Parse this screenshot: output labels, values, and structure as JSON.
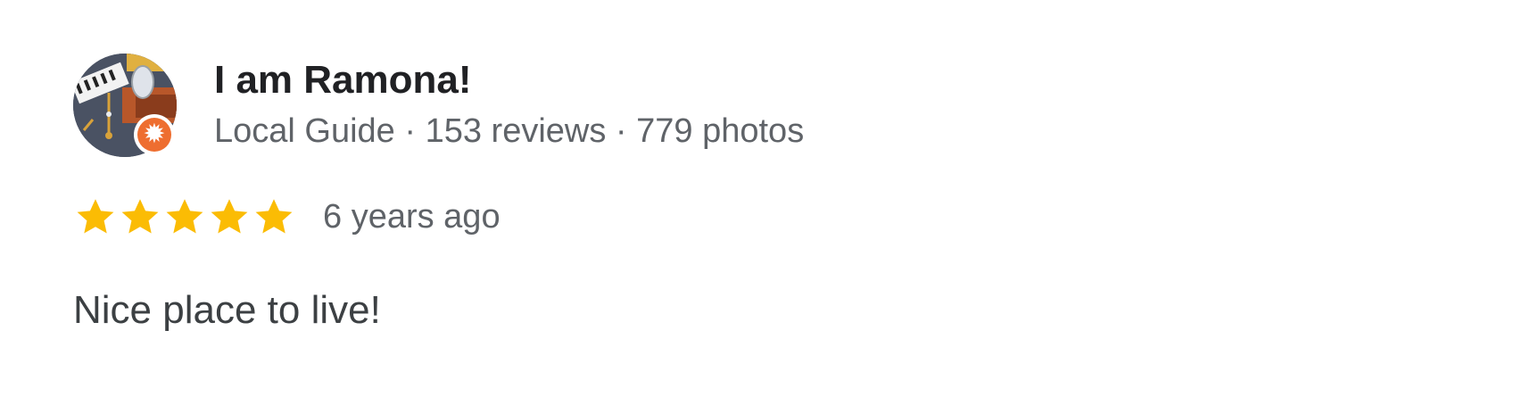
{
  "review": {
    "reviewer": {
      "name": "I am Ramona!",
      "guide_label": "Local Guide",
      "separator": "·",
      "reviews_count": "153 reviews",
      "photos_count": "779 photos",
      "avatar_icon": "profile-photo",
      "badge_icon": "local-guide-badge-icon"
    },
    "rating": {
      "stars": 5,
      "max_stars": 5,
      "star_color": "#fbbc04",
      "time": "6 years ago"
    },
    "text": "Nice place to live!"
  },
  "colors": {
    "name": "#202124",
    "meta": "#5f6368",
    "body_text": "#3c4043",
    "badge": "#ee6e30"
  }
}
